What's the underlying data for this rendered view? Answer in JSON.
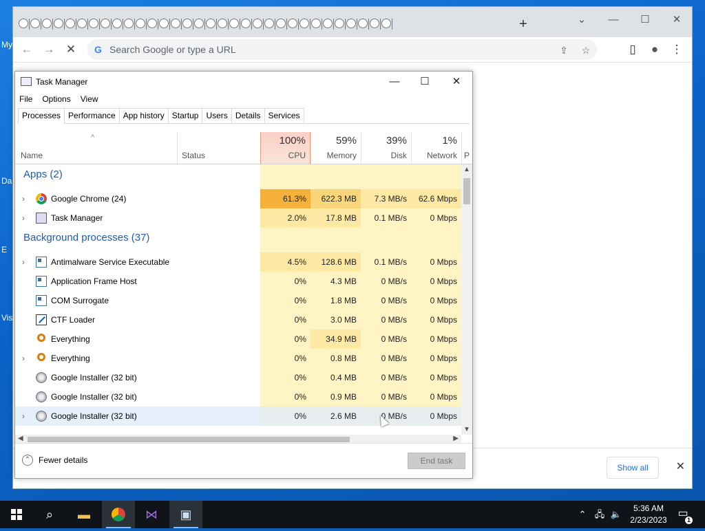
{
  "desktop": {
    "labels": [
      "My",
      "Da",
      "E",
      "Vis"
    ]
  },
  "browser": {
    "new_tab": "+",
    "omnibox_placeholder": "Search Google or type a URL",
    "omnibox_g": "G",
    "show_all": "Show all"
  },
  "taskmgr": {
    "title": "Task Manager",
    "menu": [
      "File",
      "Options",
      "View"
    ],
    "tabs": [
      "Processes",
      "Performance",
      "App history",
      "Startup",
      "Users",
      "Details",
      "Services"
    ],
    "active_tab": "Processes",
    "columns": {
      "name": "Name",
      "status": "Status",
      "cpu": {
        "pct": "100%",
        "label": "CPU"
      },
      "memory": {
        "pct": "59%",
        "label": "Memory"
      },
      "disk": {
        "pct": "39%",
        "label": "Disk"
      },
      "network": {
        "pct": "1%",
        "label": "Network"
      },
      "next": "P"
    },
    "groups": {
      "apps": "Apps (2)",
      "background": "Background processes (37)"
    },
    "apps": [
      {
        "name": "Google Chrome (24)",
        "cpu": "61.3%",
        "mem": "622.3 MB",
        "disk": "7.3 MB/s",
        "net": "62.6 Mbps",
        "icon": "chrome-icon",
        "expand": true
      },
      {
        "name": "Task Manager",
        "cpu": "2.0%",
        "mem": "17.8 MB",
        "disk": "0.1 MB/s",
        "net": "0 Mbps",
        "icon": "task-manager-icon",
        "expand": true
      }
    ],
    "background": [
      {
        "name": "Antimalware Service Executable",
        "cpu": "4.5%",
        "mem": "128.6 MB",
        "disk": "0.1 MB/s",
        "net": "0 Mbps",
        "icon": "window-icon",
        "expand": true
      },
      {
        "name": "Application Frame Host",
        "cpu": "0%",
        "mem": "4.3 MB",
        "disk": "0 MB/s",
        "net": "0 Mbps",
        "icon": "window-icon",
        "expand": false
      },
      {
        "name": "COM Surrogate",
        "cpu": "0%",
        "mem": "1.8 MB",
        "disk": "0 MB/s",
        "net": "0 Mbps",
        "icon": "window-icon",
        "expand": false
      },
      {
        "name": "CTF Loader",
        "cpu": "0%",
        "mem": "3.0 MB",
        "disk": "0 MB/s",
        "net": "0 Mbps",
        "icon": "pen-icon",
        "expand": false
      },
      {
        "name": "Everything",
        "cpu": "0%",
        "mem": "34.9 MB",
        "disk": "0 MB/s",
        "net": "0 Mbps",
        "icon": "magnifier-icon",
        "expand": false
      },
      {
        "name": "Everything",
        "cpu": "0%",
        "mem": "0.8 MB",
        "disk": "0 MB/s",
        "net": "0 Mbps",
        "icon": "magnifier-icon",
        "expand": true
      },
      {
        "name": "Google Installer (32 bit)",
        "cpu": "0%",
        "mem": "0.4 MB",
        "disk": "0 MB/s",
        "net": "0 Mbps",
        "icon": "installer-icon",
        "expand": false
      },
      {
        "name": "Google Installer (32 bit)",
        "cpu": "0%",
        "mem": "0.9 MB",
        "disk": "0 MB/s",
        "net": "0 Mbps",
        "icon": "installer-icon",
        "expand": false
      },
      {
        "name": "Google Installer (32 bit)",
        "cpu": "0%",
        "mem": "2.6 MB",
        "disk": "0 MB/s",
        "net": "0 Mbps",
        "icon": "installer-icon",
        "expand": true,
        "selected": true
      }
    ],
    "fewer_details": "Fewer details",
    "end_task": "End task"
  },
  "taskbar": {
    "clock_time": "5:36 AM",
    "clock_date": "2/23/2023",
    "notification_count": "1"
  }
}
